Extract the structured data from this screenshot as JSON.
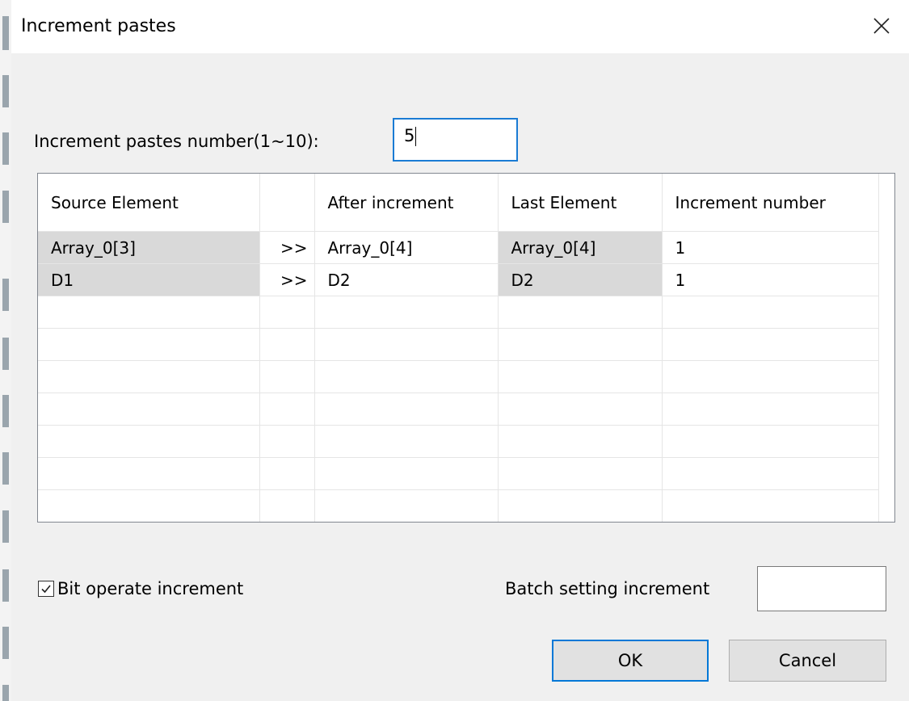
{
  "window": {
    "title": "Increment pastes",
    "close_icon": "close-icon"
  },
  "count": {
    "label": "Increment pastes number(1~10):",
    "value": "5"
  },
  "table": {
    "columns": [
      "Source Element",
      "",
      "After increment",
      "Last Element",
      "Increment number"
    ],
    "rows": [
      {
        "source": "Array_0[3]",
        "arrow": ">>",
        "after": "Array_0[4]",
        "last": "Array_0[4]",
        "increment": "1"
      },
      {
        "source": "D1",
        "arrow": ">>",
        "after": "D2",
        "last": "D2",
        "increment": "1"
      }
    ],
    "empty_rows": 7
  },
  "options": {
    "bit_operate_label": "Bit operate increment",
    "bit_operate_checked": true,
    "batch_label": "Batch setting increment",
    "batch_value": ""
  },
  "buttons": {
    "ok": "OK",
    "cancel": "Cancel"
  },
  "colors": {
    "focus_border": "#1a7bd4",
    "shaded_cell": "#d9d9d9",
    "dialog_bg": "#f0f0f0"
  }
}
